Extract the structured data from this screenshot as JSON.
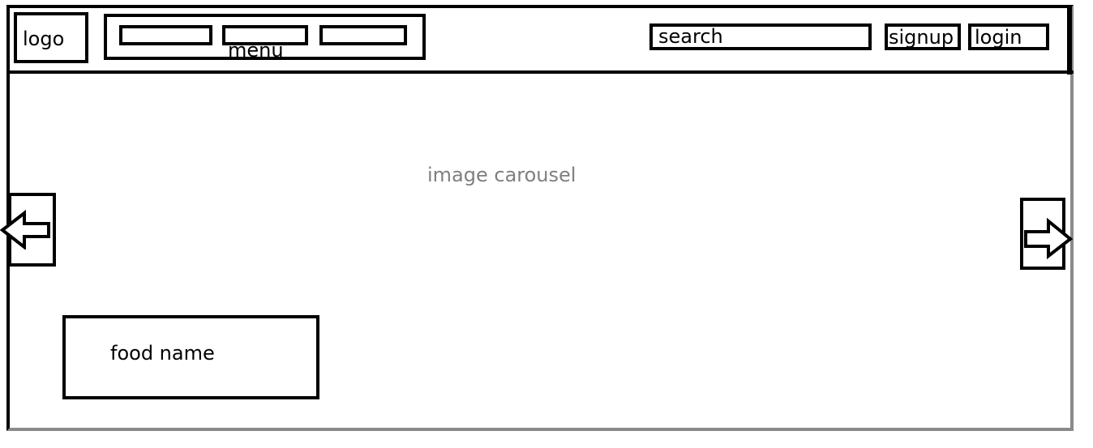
{
  "header": {
    "logo_label": "logo",
    "menu_label": "menu",
    "search_label": "search",
    "signup_label": "signup",
    "login_label": "login"
  },
  "carousel": {
    "label": "image carousel",
    "prev_icon": "arrow-left-icon",
    "next_icon": "arrow-right-icon",
    "caption": "food name"
  },
  "colors": {
    "outline": "#000000",
    "placeholder_text": "#7f7f7f"
  }
}
